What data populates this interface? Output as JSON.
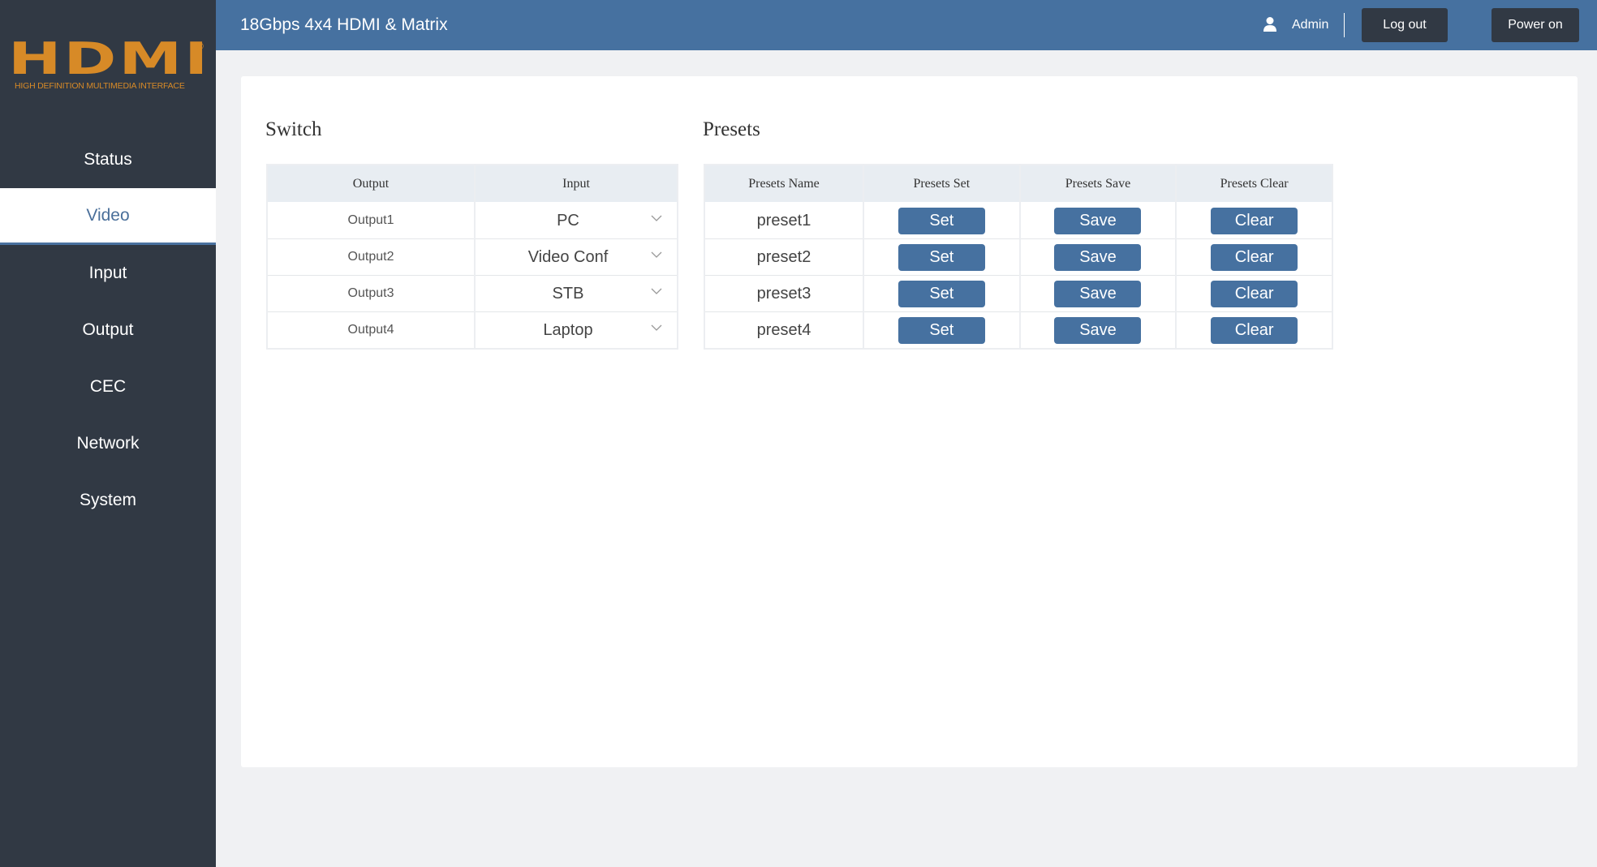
{
  "logo": {
    "word": "HDMI",
    "reg": "®",
    "subtitle": "HIGH DEFINITION MULTIMEDIA INTERFACE"
  },
  "sidebar": {
    "items": [
      {
        "label": "Status",
        "active": false
      },
      {
        "label": "Video",
        "active": true
      },
      {
        "label": "Input",
        "active": false
      },
      {
        "label": "Output",
        "active": false
      },
      {
        "label": "CEC",
        "active": false
      },
      {
        "label": "Network",
        "active": false
      },
      {
        "label": "System",
        "active": false
      }
    ]
  },
  "header": {
    "title": "18Gbps 4x4 HDMI & Matrix",
    "user": "Admin",
    "logout_label": "Log out",
    "power_label": "Power on"
  },
  "switch": {
    "title": "Switch",
    "columns": [
      "Output",
      "Input"
    ],
    "rows": [
      {
        "output": "Output1",
        "input": "PC"
      },
      {
        "output": "Output2",
        "input": "Video Conf"
      },
      {
        "output": "Output3",
        "input": "STB"
      },
      {
        "output": "Output4",
        "input": "Laptop"
      }
    ]
  },
  "presets": {
    "title": "Presets",
    "columns": [
      "Presets Name",
      "Presets Set",
      "Presets Save",
      "Presets Clear"
    ],
    "set_label": "Set",
    "save_label": "Save",
    "clear_label": "Clear",
    "rows": [
      {
        "name": "preset1"
      },
      {
        "name": "preset2"
      },
      {
        "name": "preset3"
      },
      {
        "name": "preset4"
      }
    ]
  },
  "colors": {
    "header": "#4671a0",
    "sidebar": "#313944",
    "accent": "#d78a27",
    "button": "#4671a0"
  }
}
